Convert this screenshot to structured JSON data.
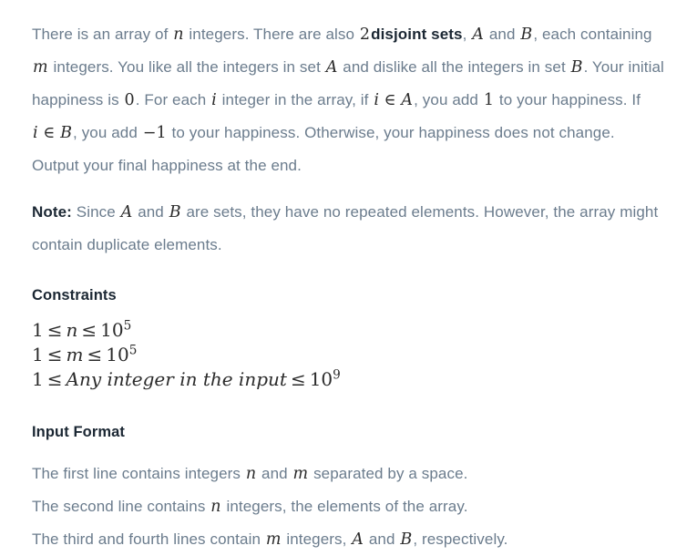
{
  "document": {
    "type": "problem-statement",
    "colors": {
      "background": "#ffffff",
      "body_text": "#6b7c8d",
      "heading_text": "#1b2733",
      "math_text": "#2b2b2b"
    }
  },
  "description": {
    "segment_1": "There is an array of ",
    "var_n": "n",
    "segment_2": " integers. There are also ",
    "num_2": "2",
    "bold_disjoint": "disjoint sets",
    "segment_3": ", ",
    "var_A1": "A",
    "segment_4": " and ",
    "var_B1": "B",
    "segment_5": ", each containing ",
    "var_m": "m",
    "segment_6": " integers. You like all the integers in set ",
    "var_A2": "A",
    "segment_7": " and dislike all the integers in set ",
    "var_B2": "B",
    "segment_8": ". Your initial happiness is ",
    "num_0": "0",
    "segment_9": ". For each ",
    "var_i1": "i",
    "segment_10": " integer in the array, if ",
    "expr_i_in_A": "i ∈ A",
    "segment_11": ", you add ",
    "num_1": "1",
    "segment_12": " to your happiness. If ",
    "expr_i_in_B": "i ∈ B",
    "segment_13": ", you add ",
    "num_minus1": "−1",
    "segment_14": " to your happiness. Otherwise, your happiness does not change. Output your final happiness at the end."
  },
  "note": {
    "label": "Note:",
    "segment_1": " Since ",
    "var_A": "A",
    "segment_2": " and ",
    "var_B": "B",
    "segment_3": " are sets, they have no repeated elements. However, the array might contain duplicate elements."
  },
  "constraints": {
    "heading": "Constraints",
    "lines": [
      {
        "lower": "1",
        "op1": "≤",
        "variable": "n",
        "op2": "≤",
        "base": "10",
        "exponent": "5",
        "text": "1 ≤ n ≤ 10^5"
      },
      {
        "lower": "1",
        "op1": "≤",
        "variable": "m",
        "op2": "≤",
        "base": "10",
        "exponent": "5",
        "text": "1 ≤ m ≤ 10^5"
      },
      {
        "lower": "1",
        "op1": "≤",
        "variable": "Any integer in the input",
        "op2": "≤",
        "base": "10",
        "exponent": "9",
        "text": "1 ≤ Any integer in the input ≤ 10^9"
      }
    ]
  },
  "input_format": {
    "heading": "Input Format",
    "lines": [
      {
        "segment_1": "The first line contains integers ",
        "var_1": "n",
        "segment_2": " and ",
        "var_2": "m",
        "segment_3": " separated by a space."
      },
      {
        "segment_1": "The second line contains ",
        "var_1": "n",
        "segment_2": " integers, the elements of the array.",
        "var_2": "",
        "segment_3": ""
      },
      {
        "segment_1": "The third and fourth lines contain ",
        "var_1": "m",
        "segment_2": " integers, ",
        "var_2": "A",
        "segment_3": " and ",
        "var_3": "B",
        "segment_4": ", respectively."
      }
    ]
  }
}
